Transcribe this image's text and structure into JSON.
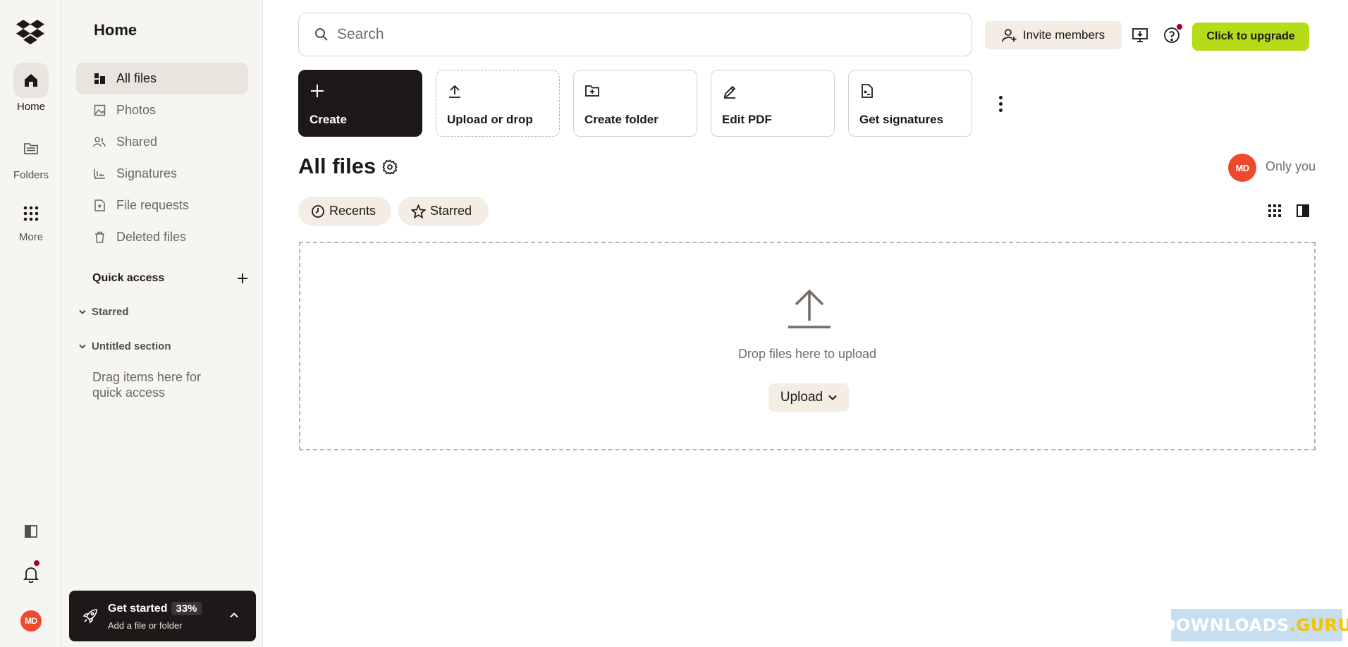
{
  "rail": {
    "items": [
      {
        "label": "Home",
        "icon": "home-icon"
      },
      {
        "label": "Folders",
        "icon": "folder-icon"
      },
      {
        "label": "More",
        "icon": "grid-icon"
      }
    ],
    "avatar_initials": "MD",
    "avatar_color": "#f0482c"
  },
  "sidebar": {
    "title": "Home",
    "nav": [
      {
        "label": "All files",
        "icon": "all-files-icon",
        "active": true
      },
      {
        "label": "Photos",
        "icon": "photos-icon"
      },
      {
        "label": "Shared",
        "icon": "shared-icon"
      },
      {
        "label": "Signatures",
        "icon": "signatures-icon"
      },
      {
        "label": "File requests",
        "icon": "file-requests-icon"
      },
      {
        "label": "Deleted files",
        "icon": "trash-icon"
      }
    ],
    "quick_access": {
      "title": "Quick access",
      "sections": [
        "Starred",
        "Untitled section"
      ],
      "hint": "Drag items here for quick access"
    },
    "get_started": {
      "title": "Get started",
      "progress": "33%",
      "subtitle": "Add a file or folder"
    }
  },
  "header": {
    "search_placeholder": "Search",
    "invite_label": "Invite members",
    "upgrade_label": "Click to upgrade",
    "upgrade_color": "#b4dc19"
  },
  "actions": [
    {
      "label": "Create",
      "icon": "plus-icon"
    },
    {
      "label": "Upload or drop",
      "icon": "upload-icon"
    },
    {
      "label": "Create folder",
      "icon": "folder-plus-icon"
    },
    {
      "label": "Edit PDF",
      "icon": "pen-icon"
    },
    {
      "label": "Get signatures",
      "icon": "signature-doc-icon"
    }
  ],
  "main": {
    "title": "All files",
    "share_avatar": "MD",
    "share_label": "Only you",
    "chips": [
      {
        "label": "Recents",
        "icon": "clock-icon"
      },
      {
        "label": "Starred",
        "icon": "star-icon"
      }
    ],
    "dropzone_text": "Drop files here to upload",
    "upload_label": "Upload"
  },
  "watermark": {
    "text": "DOWNLOADS",
    "suffix": ".GURU"
  }
}
